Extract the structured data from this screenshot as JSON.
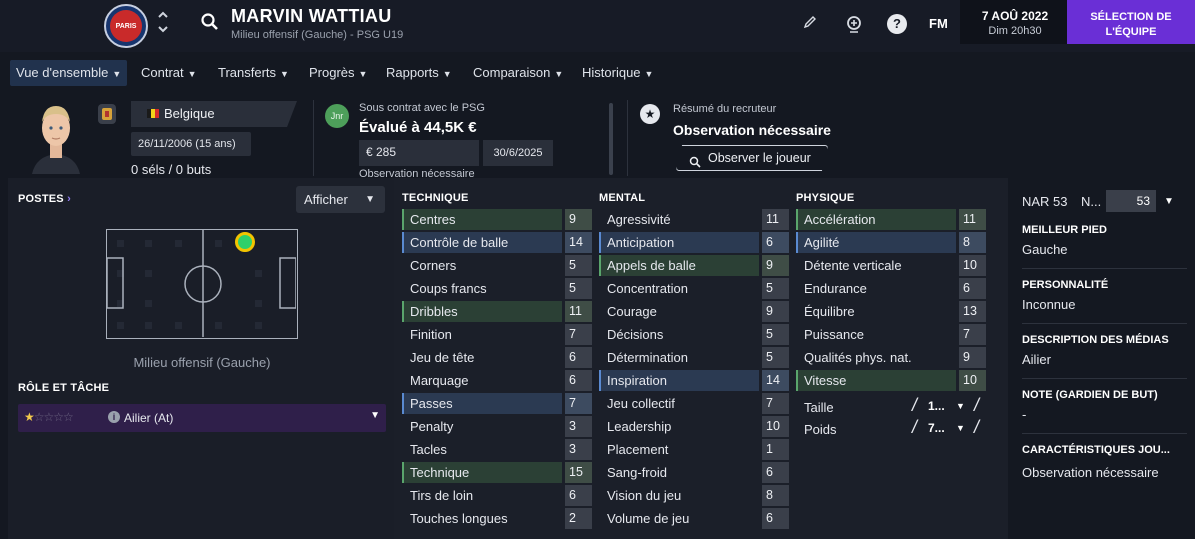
{
  "header": {
    "player_name": "MARVIN WATTIAU",
    "player_subtitle": "Milieu offensif (Gauche) - PSG U19",
    "club_badge_text": "PARIS",
    "fm_logo": "FM",
    "date": "7 AOÛ 2022",
    "day_time": "Dim 20h30",
    "team_selection": "SÉLECTION DE L'ÉQUIPE",
    "icons": [
      "back-arrow-icon",
      "forward-arrow-icon",
      "up-down-chevron-icon",
      "search-icon",
      "edit-pencil-icon",
      "trophy-ball-icon",
      "help-icon"
    ]
  },
  "tabs": [
    {
      "label": "Vue d'ensemble",
      "active": true
    },
    {
      "label": "Contrat"
    },
    {
      "label": "Transferts"
    },
    {
      "label": "Progrès"
    },
    {
      "label": "Rapports"
    },
    {
      "label": "Comparaison"
    },
    {
      "label": "Historique"
    }
  ],
  "profile": {
    "nationality": "Belgique",
    "dob": "26/11/2006 (15 ans)",
    "apps_goals": "0 séls / 0 buts",
    "flag_colors": [
      "#1a1a1a",
      "#f2d21b",
      "#d62a2a"
    ]
  },
  "contract": {
    "badge": "Jnr",
    "status": "Sous contrat avec le PSG",
    "value": "Évalué à 44,5K €",
    "wage": "€ 285",
    "expiry": "30/6/2025",
    "footnote": "Observation nécessaire"
  },
  "scout": {
    "label": "Résumé du recruteur",
    "value": "Observation nécessaire",
    "observe_button": "Observer le joueur"
  },
  "positions": {
    "heading": "POSTES",
    "show_button": "Afficher",
    "caption": "Milieu offensif (Gauche)",
    "role_heading": "RÔLE ET TÂCHE",
    "role": "Ailier (At)",
    "role_stars": 1,
    "role_stars_max": 5
  },
  "attributes": {
    "technique_title": "TECHNIQUE",
    "mental_title": "MENTAL",
    "physique_title": "PHYSIQUE",
    "technique": [
      {
        "name": "Centres",
        "value": 9,
        "hl": "green"
      },
      {
        "name": "Contrôle de balle",
        "value": 14,
        "hl": "blue"
      },
      {
        "name": "Corners",
        "value": 5
      },
      {
        "name": "Coups francs",
        "value": 5
      },
      {
        "name": "Dribbles",
        "value": 11,
        "hl": "green"
      },
      {
        "name": "Finition",
        "value": 7
      },
      {
        "name": "Jeu de tête",
        "value": 6
      },
      {
        "name": "Marquage",
        "value": 6
      },
      {
        "name": "Passes",
        "value": 7,
        "hl": "blue"
      },
      {
        "name": "Penalty",
        "value": 3
      },
      {
        "name": "Tacles",
        "value": 3
      },
      {
        "name": "Technique",
        "value": 15,
        "hl": "green"
      },
      {
        "name": "Tirs de loin",
        "value": 6
      },
      {
        "name": "Touches longues",
        "value": 2
      }
    ],
    "mental": [
      {
        "name": "Agressivité",
        "value": 11
      },
      {
        "name": "Anticipation",
        "value": 6,
        "hl": "blue"
      },
      {
        "name": "Appels de balle",
        "value": 9,
        "hl": "green"
      },
      {
        "name": "Concentration",
        "value": 5
      },
      {
        "name": "Courage",
        "value": 9
      },
      {
        "name": "Décisions",
        "value": 5
      },
      {
        "name": "Détermination",
        "value": 5
      },
      {
        "name": "Inspiration",
        "value": 14,
        "hl": "blue"
      },
      {
        "name": "Jeu collectif",
        "value": 7
      },
      {
        "name": "Leadership",
        "value": 10
      },
      {
        "name": "Placement",
        "value": 1
      },
      {
        "name": "Sang-froid",
        "value": 6
      },
      {
        "name": "Vision du jeu",
        "value": 8
      },
      {
        "name": "Volume de jeu",
        "value": 6
      }
    ],
    "physique": [
      {
        "name": "Accélération",
        "value": 11,
        "hl": "green"
      },
      {
        "name": "Agilité",
        "value": 8,
        "hl": "blue"
      },
      {
        "name": "Détente verticale",
        "value": 10
      },
      {
        "name": "Endurance",
        "value": 6
      },
      {
        "name": "Équilibre",
        "value": 13
      },
      {
        "name": "Puissance",
        "value": 7
      },
      {
        "name": "Qualités phys. nat.",
        "value": 9
      },
      {
        "name": "Vitesse",
        "value": 10,
        "hl": "green"
      }
    ],
    "height_label": "Taille",
    "height_value": "1...",
    "weight_label": "Poids",
    "weight_value": "7..."
  },
  "side": {
    "nar_label": "NAR 53",
    "nar_n": "N...",
    "nar_value": "53",
    "best_foot_head": "MEILLEUR PIED",
    "best_foot": "Gauche",
    "personality_head": "PERSONNALITÉ",
    "personality": "Inconnue",
    "media_head": "DESCRIPTION DES MÉDIAS",
    "media": "Ailier",
    "gk_head": "NOTE (GARDIEN DE BUT)",
    "gk": "-",
    "traits_head": "CARACTÉRISTIQUES JOU...",
    "traits": "Observation nécessaire"
  }
}
